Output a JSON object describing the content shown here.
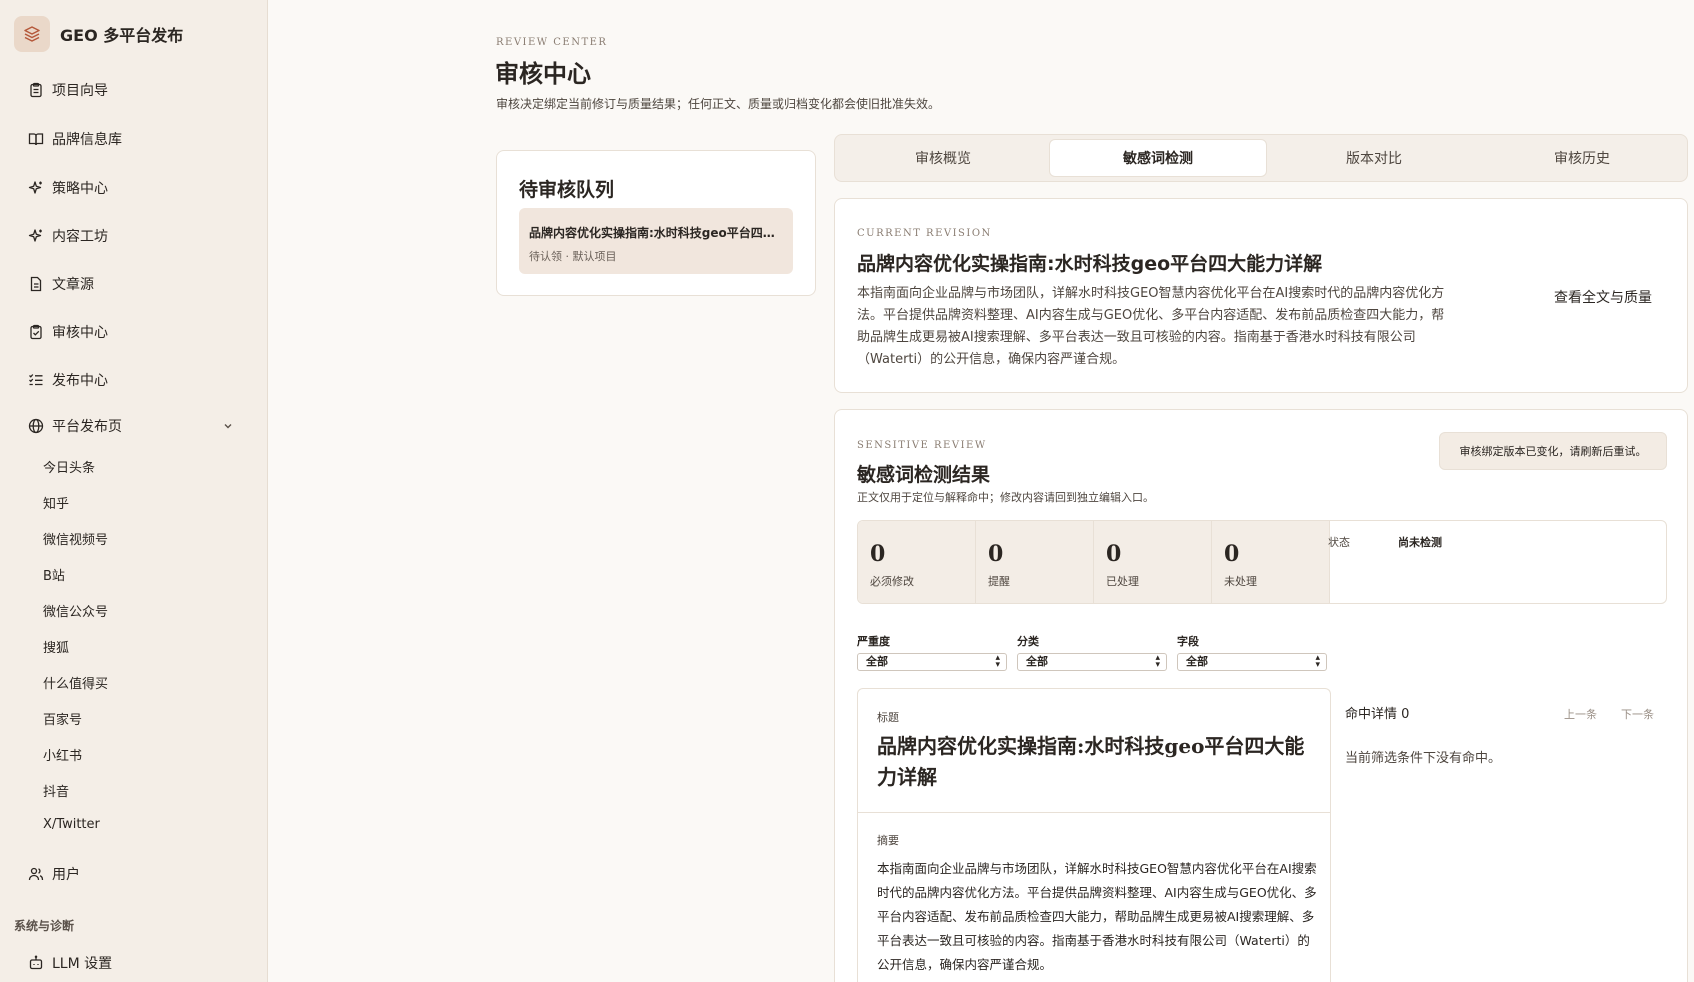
{
  "app": {
    "title": "GEO 多平台发布"
  },
  "sidebar": {
    "items": [
      {
        "label": "项目向导",
        "icon": "clipboard-icon"
      },
      {
        "label": "品牌信息库",
        "icon": "book-icon"
      },
      {
        "label": "策略中心",
        "icon": "sparkle-icon"
      },
      {
        "label": "内容工坊",
        "icon": "sparkle-icon"
      },
      {
        "label": "文章源",
        "icon": "document-icon"
      },
      {
        "label": "审核中心",
        "icon": "clipboard-check-icon"
      },
      {
        "label": "发布中心",
        "icon": "checklist-icon"
      },
      {
        "label": "平台发布页",
        "icon": "globe-icon"
      }
    ],
    "platforms": [
      "今日头条",
      "知乎",
      "微信视频号",
      "B站",
      "微信公众号",
      "搜狐",
      "什么值得买",
      "百家号",
      "小红书",
      "抖音",
      "X/Twitter"
    ],
    "user_label": "用户",
    "section_label": "系统与诊断",
    "llm_label": "LLM 设置"
  },
  "page": {
    "eyebrow": "REVIEW CENTER",
    "title": "审核中心",
    "description": "审核决定绑定当前修订与质量结果；任何正文、质量或归档变化都会使旧批准失效。"
  },
  "queue": {
    "title": "待审核队列",
    "items": [
      {
        "title": "品牌内容优化实操指南:水时科技geo平台四大能力详解",
        "meta": "待认领 · 默认项目"
      }
    ]
  },
  "tabs": [
    "审核概览",
    "敏感词检测",
    "版本对比",
    "审核历史"
  ],
  "active_tab": "敏感词检测",
  "revision": {
    "eyebrow": "CURRENT REVISION",
    "title": "品牌内容优化实操指南:水时科技geo平台四大能力详解",
    "body": "本指南面向企业品牌与市场团队，详解水时科技GEO智慧内容优化平台在AI搜索时代的品牌内容优化方法。平台提供品牌资料整理、AI内容生成与GEO优化、多平台内容适配、发布前品质检查四大能力，帮助品牌生成更易被AI搜索理解、多平台表达一致且可核验的内容。指南基于香港水时科技有限公司（Waterti）的公开信息，确保内容严谨合规。",
    "link": "查看全文与质量"
  },
  "sensitive": {
    "eyebrow": "SENSITIVE REVIEW",
    "title": "敏感词检测结果",
    "description": "正文仅用于定位与解释命中；修改内容请回到独立编辑入口。",
    "notice": "审核绑定版本已变化，请刷新后重试。",
    "stats": [
      {
        "value": "0",
        "label": "必须修改"
      },
      {
        "value": "0",
        "label": "提醒"
      },
      {
        "value": "0",
        "label": "已处理"
      },
      {
        "value": "0",
        "label": "未处理"
      }
    ],
    "status_label": "状态",
    "status_value": "尚未检测",
    "filters": [
      {
        "label": "严重度",
        "value": "全部"
      },
      {
        "label": "分类",
        "value": "全部"
      },
      {
        "label": "字段",
        "value": "全部"
      }
    ],
    "preview": {
      "title_label": "标题",
      "title": "品牌内容优化实操指南:水时科技geo平台四大能力详解",
      "summary_label": "摘要",
      "summary": "本指南面向企业品牌与市场团队，详解水时科技GEO智慧内容优化平台在AI搜索时代的品牌内容优化方法。平台提供品牌资料整理、AI内容生成与GEO优化、多平台内容适配、发布前品质检查四大能力，帮助品牌生成更易被AI搜索理解、多平台表达一致且可核验的内容。指南基于香港水时科技有限公司（Waterti）的公开信息，确保内容严谨合规。"
    },
    "hits": {
      "title": "命中详情 0",
      "prev": "上一条",
      "next": "下一条",
      "empty": "当前筛选条件下没有命中。"
    }
  }
}
